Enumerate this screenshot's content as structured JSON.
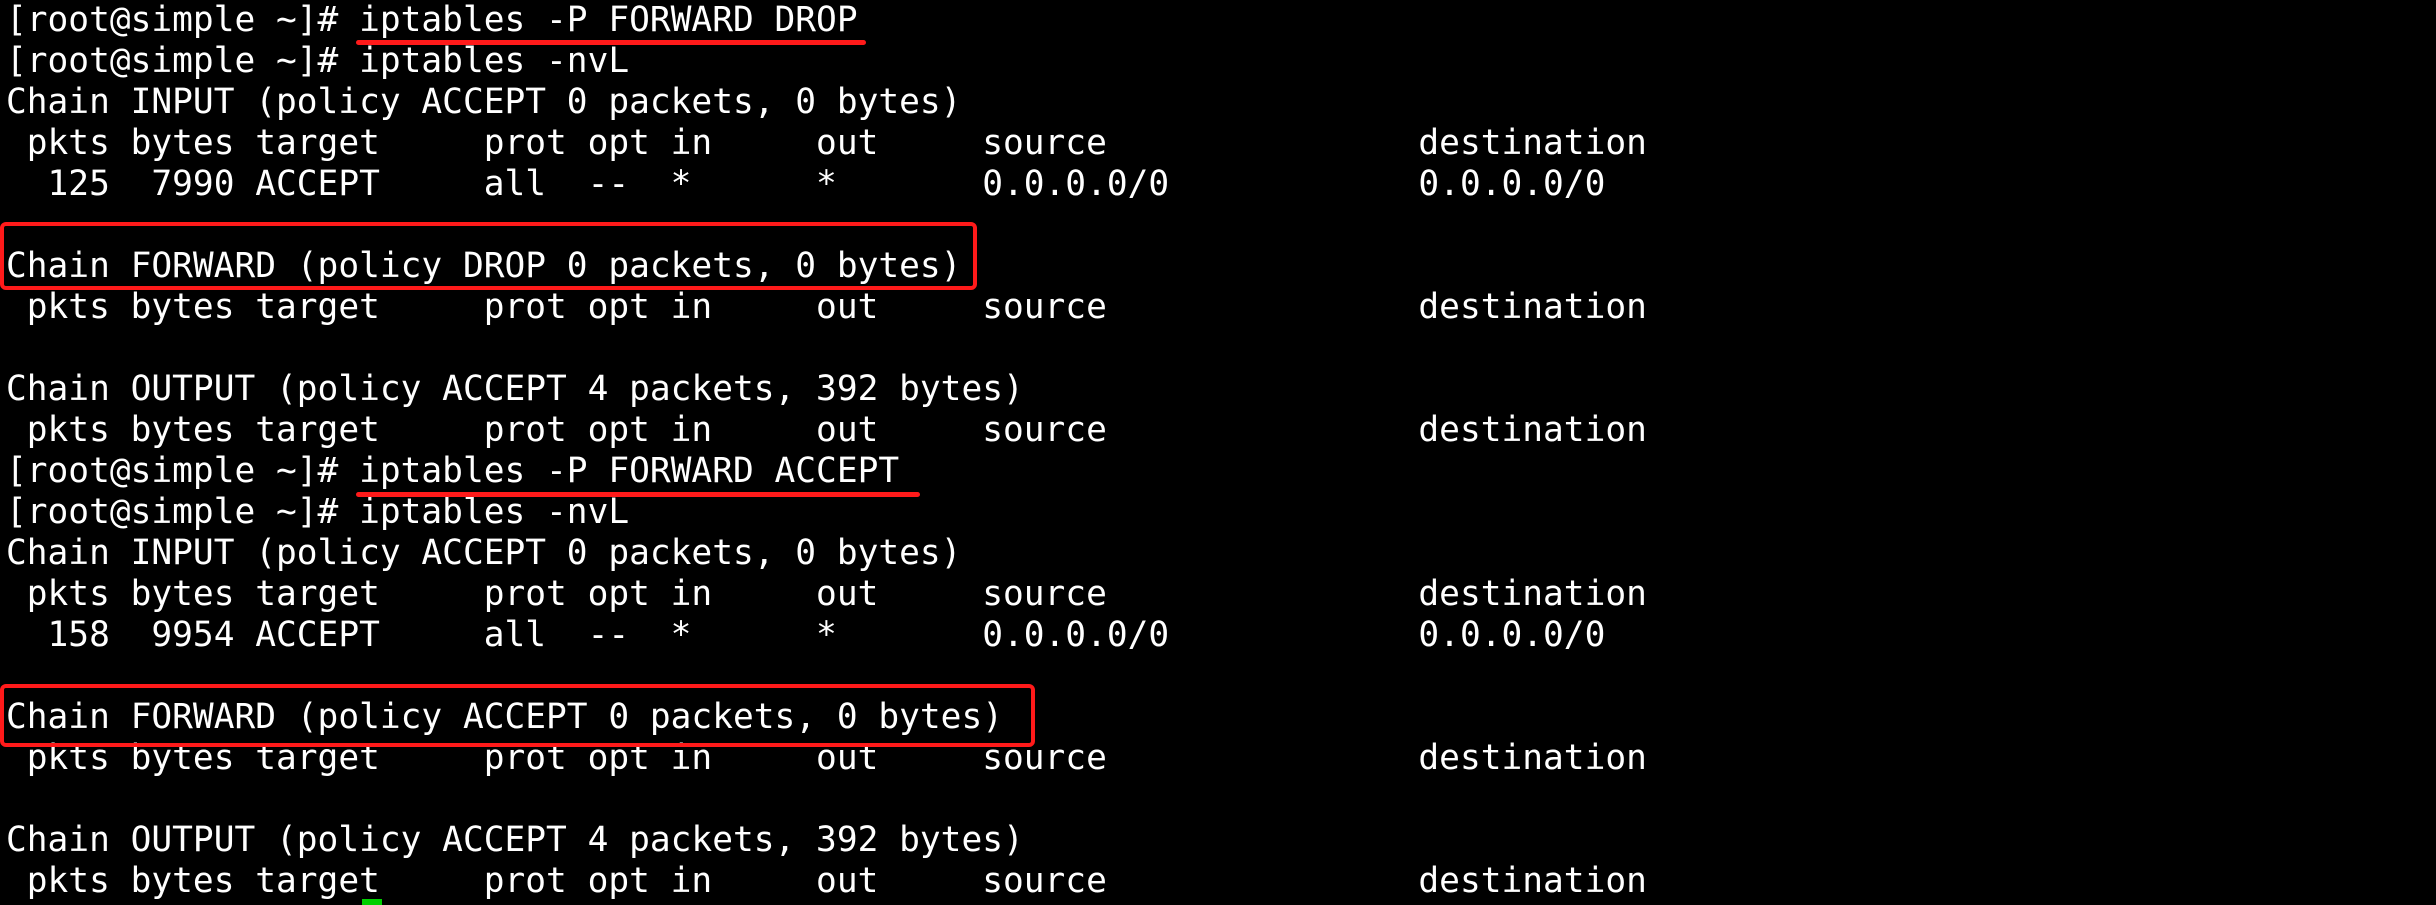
{
  "terminal": {
    "lines": [
      "[root@simple ~]# iptables -P FORWARD DROP",
      "[root@simple ~]# iptables -nvL",
      "Chain INPUT (policy ACCEPT 0 packets, 0 bytes)",
      " pkts bytes target     prot opt in     out     source               destination",
      "  125  7990 ACCEPT     all  --  *      *       0.0.0.0/0            0.0.0.0/0",
      "",
      "Chain FORWARD (policy DROP 0 packets, 0 bytes)",
      " pkts bytes target     prot opt in     out     source               destination",
      "",
      "Chain OUTPUT (policy ACCEPT 4 packets, 392 bytes)",
      " pkts bytes target     prot opt in     out     source               destination",
      "[root@simple ~]# iptables -P FORWARD ACCEPT",
      "[root@simple ~]# iptables -nvL",
      "Chain INPUT (policy ACCEPT 0 packets, 0 bytes)",
      " pkts bytes target     prot opt in     out     source               destination",
      "  158  9954 ACCEPT     all  --  *      *       0.0.0.0/0            0.0.0.0/0",
      "",
      "Chain FORWARD (policy ACCEPT 0 packets, 0 bytes)",
      " pkts bytes target     prot opt in     out     source               destination",
      "",
      "Chain OUTPUT (policy ACCEPT 4 packets, 392 bytes)",
      " pkts bytes target     prot opt in     out     source               destination"
    ]
  },
  "colors": {
    "background": "#000000",
    "text": "#ffffff",
    "annotation": "#ff1a1a",
    "cursor": "#00d000"
  }
}
